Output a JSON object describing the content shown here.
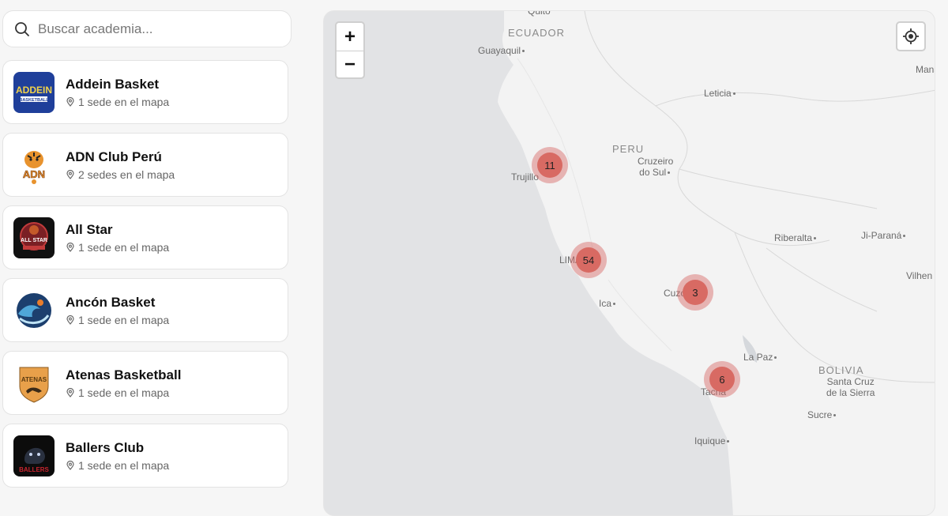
{
  "search": {
    "placeholder": "Buscar academia..."
  },
  "academies": [
    {
      "name": "Addein Basket",
      "sedes": "1 sede en el mapa",
      "logo": "addein-logo"
    },
    {
      "name": "ADN Club Perú",
      "sedes": "2 sedes en el mapa",
      "logo": "adn-tiger-logo"
    },
    {
      "name": "All Star",
      "sedes": "1 sede en el mapa",
      "logo": "all-star-logo"
    },
    {
      "name": "Ancón Basket",
      "sedes": "1 sede en el mapa",
      "logo": "ancon-wave-logo"
    },
    {
      "name": "Atenas Basketball",
      "sedes": "1 sede en el mapa",
      "logo": "atenas-shield-logo"
    },
    {
      "name": "Ballers Club",
      "sedes": "1 sede en el mapa",
      "logo": "ballers-panther-logo"
    }
  ],
  "logo_text": {
    "addein": "ADDEIN",
    "addein_sub": "BASKETBALL",
    "adn": "ADN",
    "allstar": "ALL STAR",
    "atenas": "ATENAS",
    "ballers": "BALLERS"
  },
  "map": {
    "zoom_in": "+",
    "zoom_out": "−",
    "labels": {
      "quito": "Quito",
      "ecuador": "ECUADOR",
      "guayaquil": "Guayaquil",
      "leticia": "Leticia",
      "peru": "PERU",
      "cruzeiro": "Cruzeiro",
      "do_sul": "do Sul",
      "manaus": "Mana",
      "trujillo": "Trujillo",
      "riberalta": "Riberalta",
      "ji_parana": "Ji-Paraná",
      "vilhena": "Vilhen",
      "lima": "LIMA",
      "ica": "Ica",
      "cuzco": "Cuzco",
      "la_paz": "La Paz",
      "bolivia": "BOLIVIA",
      "santa_cruz_1": "Santa Cruz",
      "santa_cruz_2": "de la Sierra",
      "tacna": "Tacna",
      "sucre": "Sucre",
      "iquique": "Iquique"
    },
    "clusters": [
      {
        "name": "trujillo",
        "count": "11"
      },
      {
        "name": "lima",
        "count": "54"
      },
      {
        "name": "cuzco",
        "count": "3"
      },
      {
        "name": "tacna",
        "count": "6"
      }
    ]
  },
  "colors": {
    "cluster": "#d86a63",
    "ocean": "#e2e3e5",
    "land": "#f3f3f3",
    "addein_blue": "#1f3f9a"
  }
}
